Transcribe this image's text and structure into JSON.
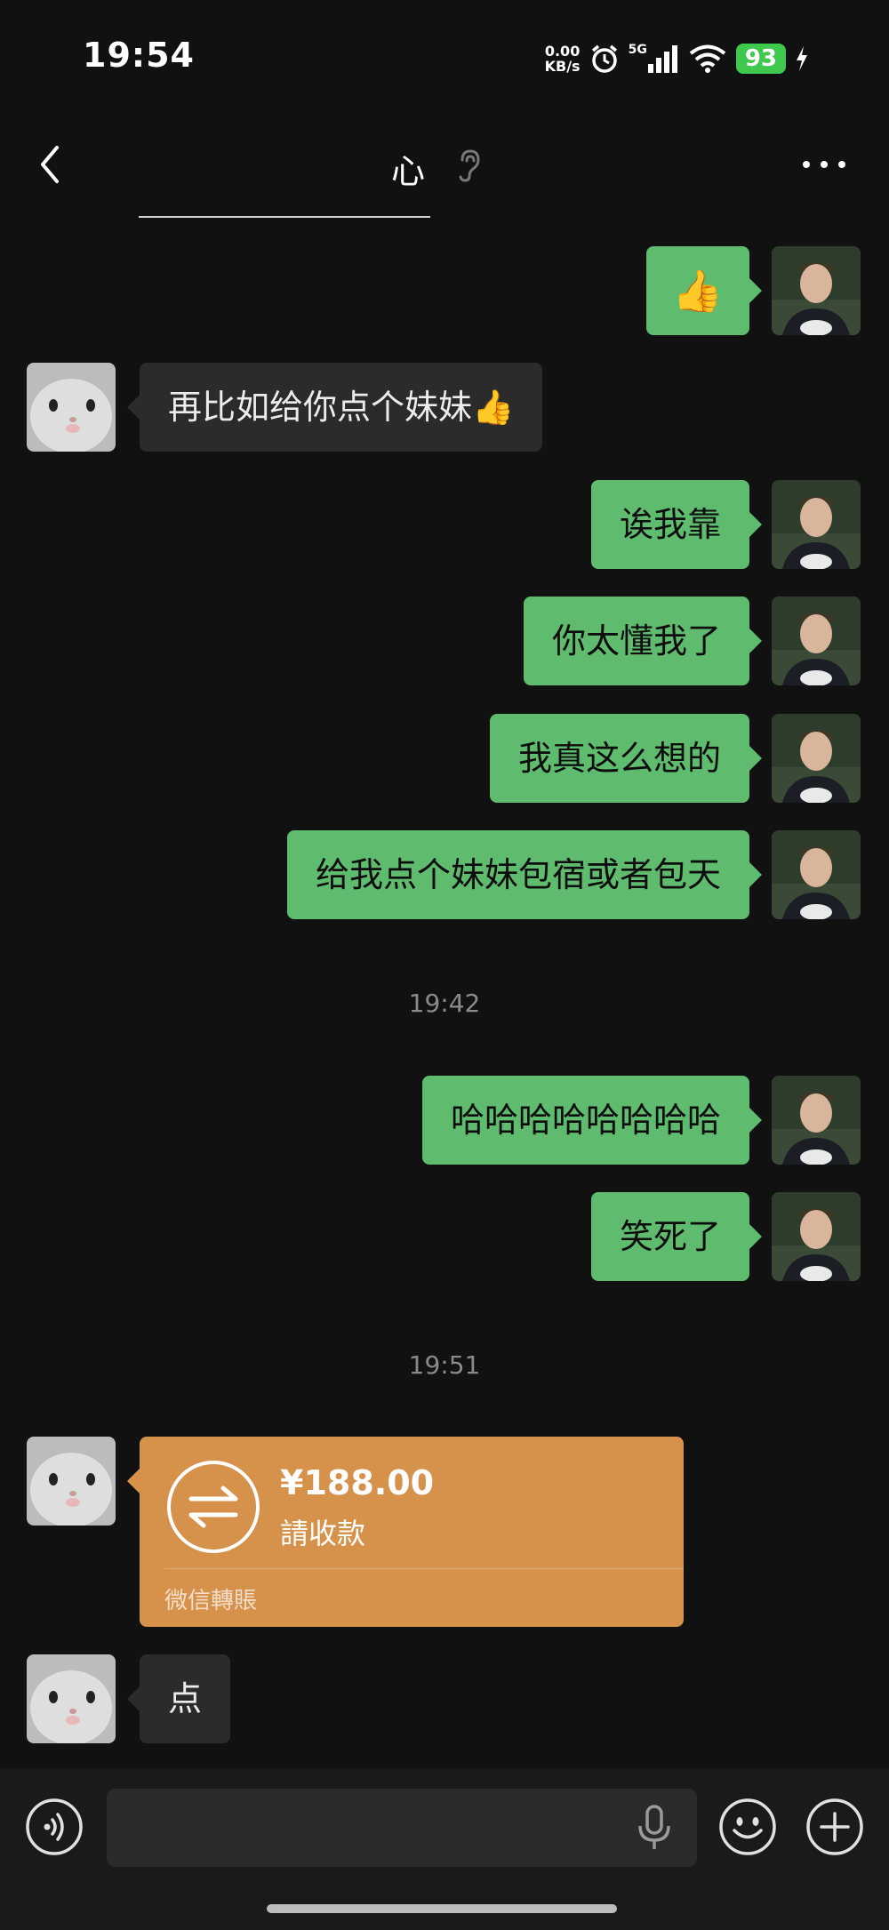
{
  "status_bar": {
    "time": "19:54",
    "net_speed_value": "0.00",
    "net_speed_unit": "KB/s",
    "signal_label": "5G",
    "battery": "93"
  },
  "header": {
    "title": "心"
  },
  "messages": [
    {
      "direction": "out",
      "type": "emoji",
      "text": "👍"
    },
    {
      "direction": "in",
      "type": "text",
      "text": "再比如给你点个妹妹👍"
    },
    {
      "direction": "out",
      "type": "text",
      "text": "诶我靠"
    },
    {
      "direction": "out",
      "type": "text",
      "text": "你太懂我了"
    },
    {
      "direction": "out",
      "type": "text",
      "text": "我真这么想的"
    },
    {
      "direction": "out",
      "type": "text",
      "text": "给我点个妹妹包宿或者包天"
    },
    {
      "type": "timestamp",
      "text": "19:42"
    },
    {
      "direction": "out",
      "type": "text",
      "text": "哈哈哈哈哈哈哈哈"
    },
    {
      "direction": "out",
      "type": "text",
      "text": "笑死了"
    },
    {
      "type": "timestamp",
      "text": "19:51"
    },
    {
      "direction": "in",
      "type": "transfer",
      "amount": "¥188.00",
      "note": "請收款",
      "footer": "微信轉賬"
    },
    {
      "direction": "in",
      "type": "text",
      "text": "点"
    }
  ],
  "colors": {
    "background": "#111111",
    "outgoing_bubble": "#5fbc6f",
    "incoming_bubble": "#2b2b2b",
    "transfer_card": "#d6914a",
    "battery": "#3ec94e"
  },
  "icons": [
    "back-arrow-icon",
    "ear-icon",
    "more-icon",
    "voice-icon",
    "mic-icon",
    "emoji-icon",
    "plus-icon",
    "transfer-arrows-icon"
  ]
}
